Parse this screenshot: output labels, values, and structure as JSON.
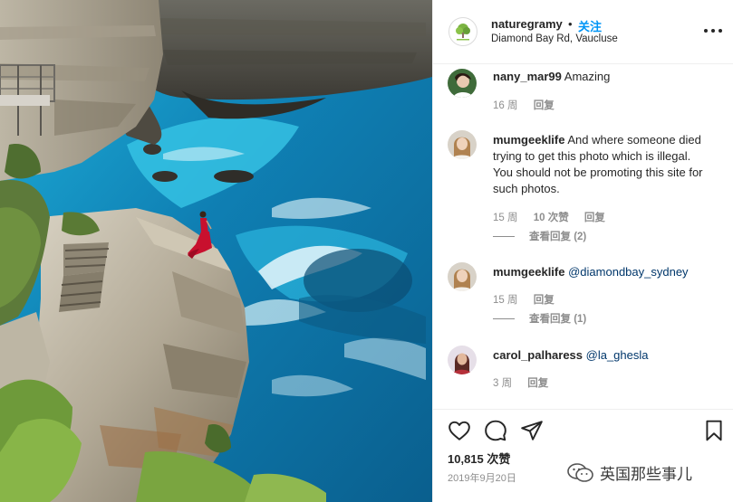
{
  "post": {
    "username": "naturegramy",
    "dot": "•",
    "follow_label": "关注",
    "location": "Diamond Bay Rd, Vaucluse"
  },
  "comments": [
    {
      "username": "nany_mar99",
      "text": "Amazing",
      "time": "16 周",
      "reply_label": "回复"
    },
    {
      "username": "mumgeeklife",
      "text": "And where someone died trying to get this photo which is illegal. You should not be promoting this site for such photos.",
      "time": "15 周",
      "likes": "10 次赞",
      "reply_label": "回复",
      "view_replies": "查看回复 (2)"
    },
    {
      "username": "mumgeeklife",
      "mention": "@diamondbay_sydney",
      "time": "15 周",
      "reply_label": "回复",
      "view_replies": "查看回复 (1)"
    },
    {
      "username": "carol_palharess",
      "mention": "@la_ghesla",
      "time": "3 周",
      "reply_label": "回复"
    }
  ],
  "actions": {
    "like_icon": "heart-icon",
    "comment_icon": "comment-bubble-icon",
    "share_icon": "paper-plane-icon",
    "save_icon": "bookmark-icon",
    "likes_count": "10,815 次赞",
    "date": "2019年9月20日"
  },
  "watermark": {
    "text": "英国那些事儿",
    "icon": "wechat-icon"
  },
  "colors": {
    "accent": "#0095f6",
    "mention": "#00376b",
    "muted": "#8e8e8e",
    "text": "#262626",
    "dress": "#c8102e",
    "ocean": "#1aa7d6"
  }
}
